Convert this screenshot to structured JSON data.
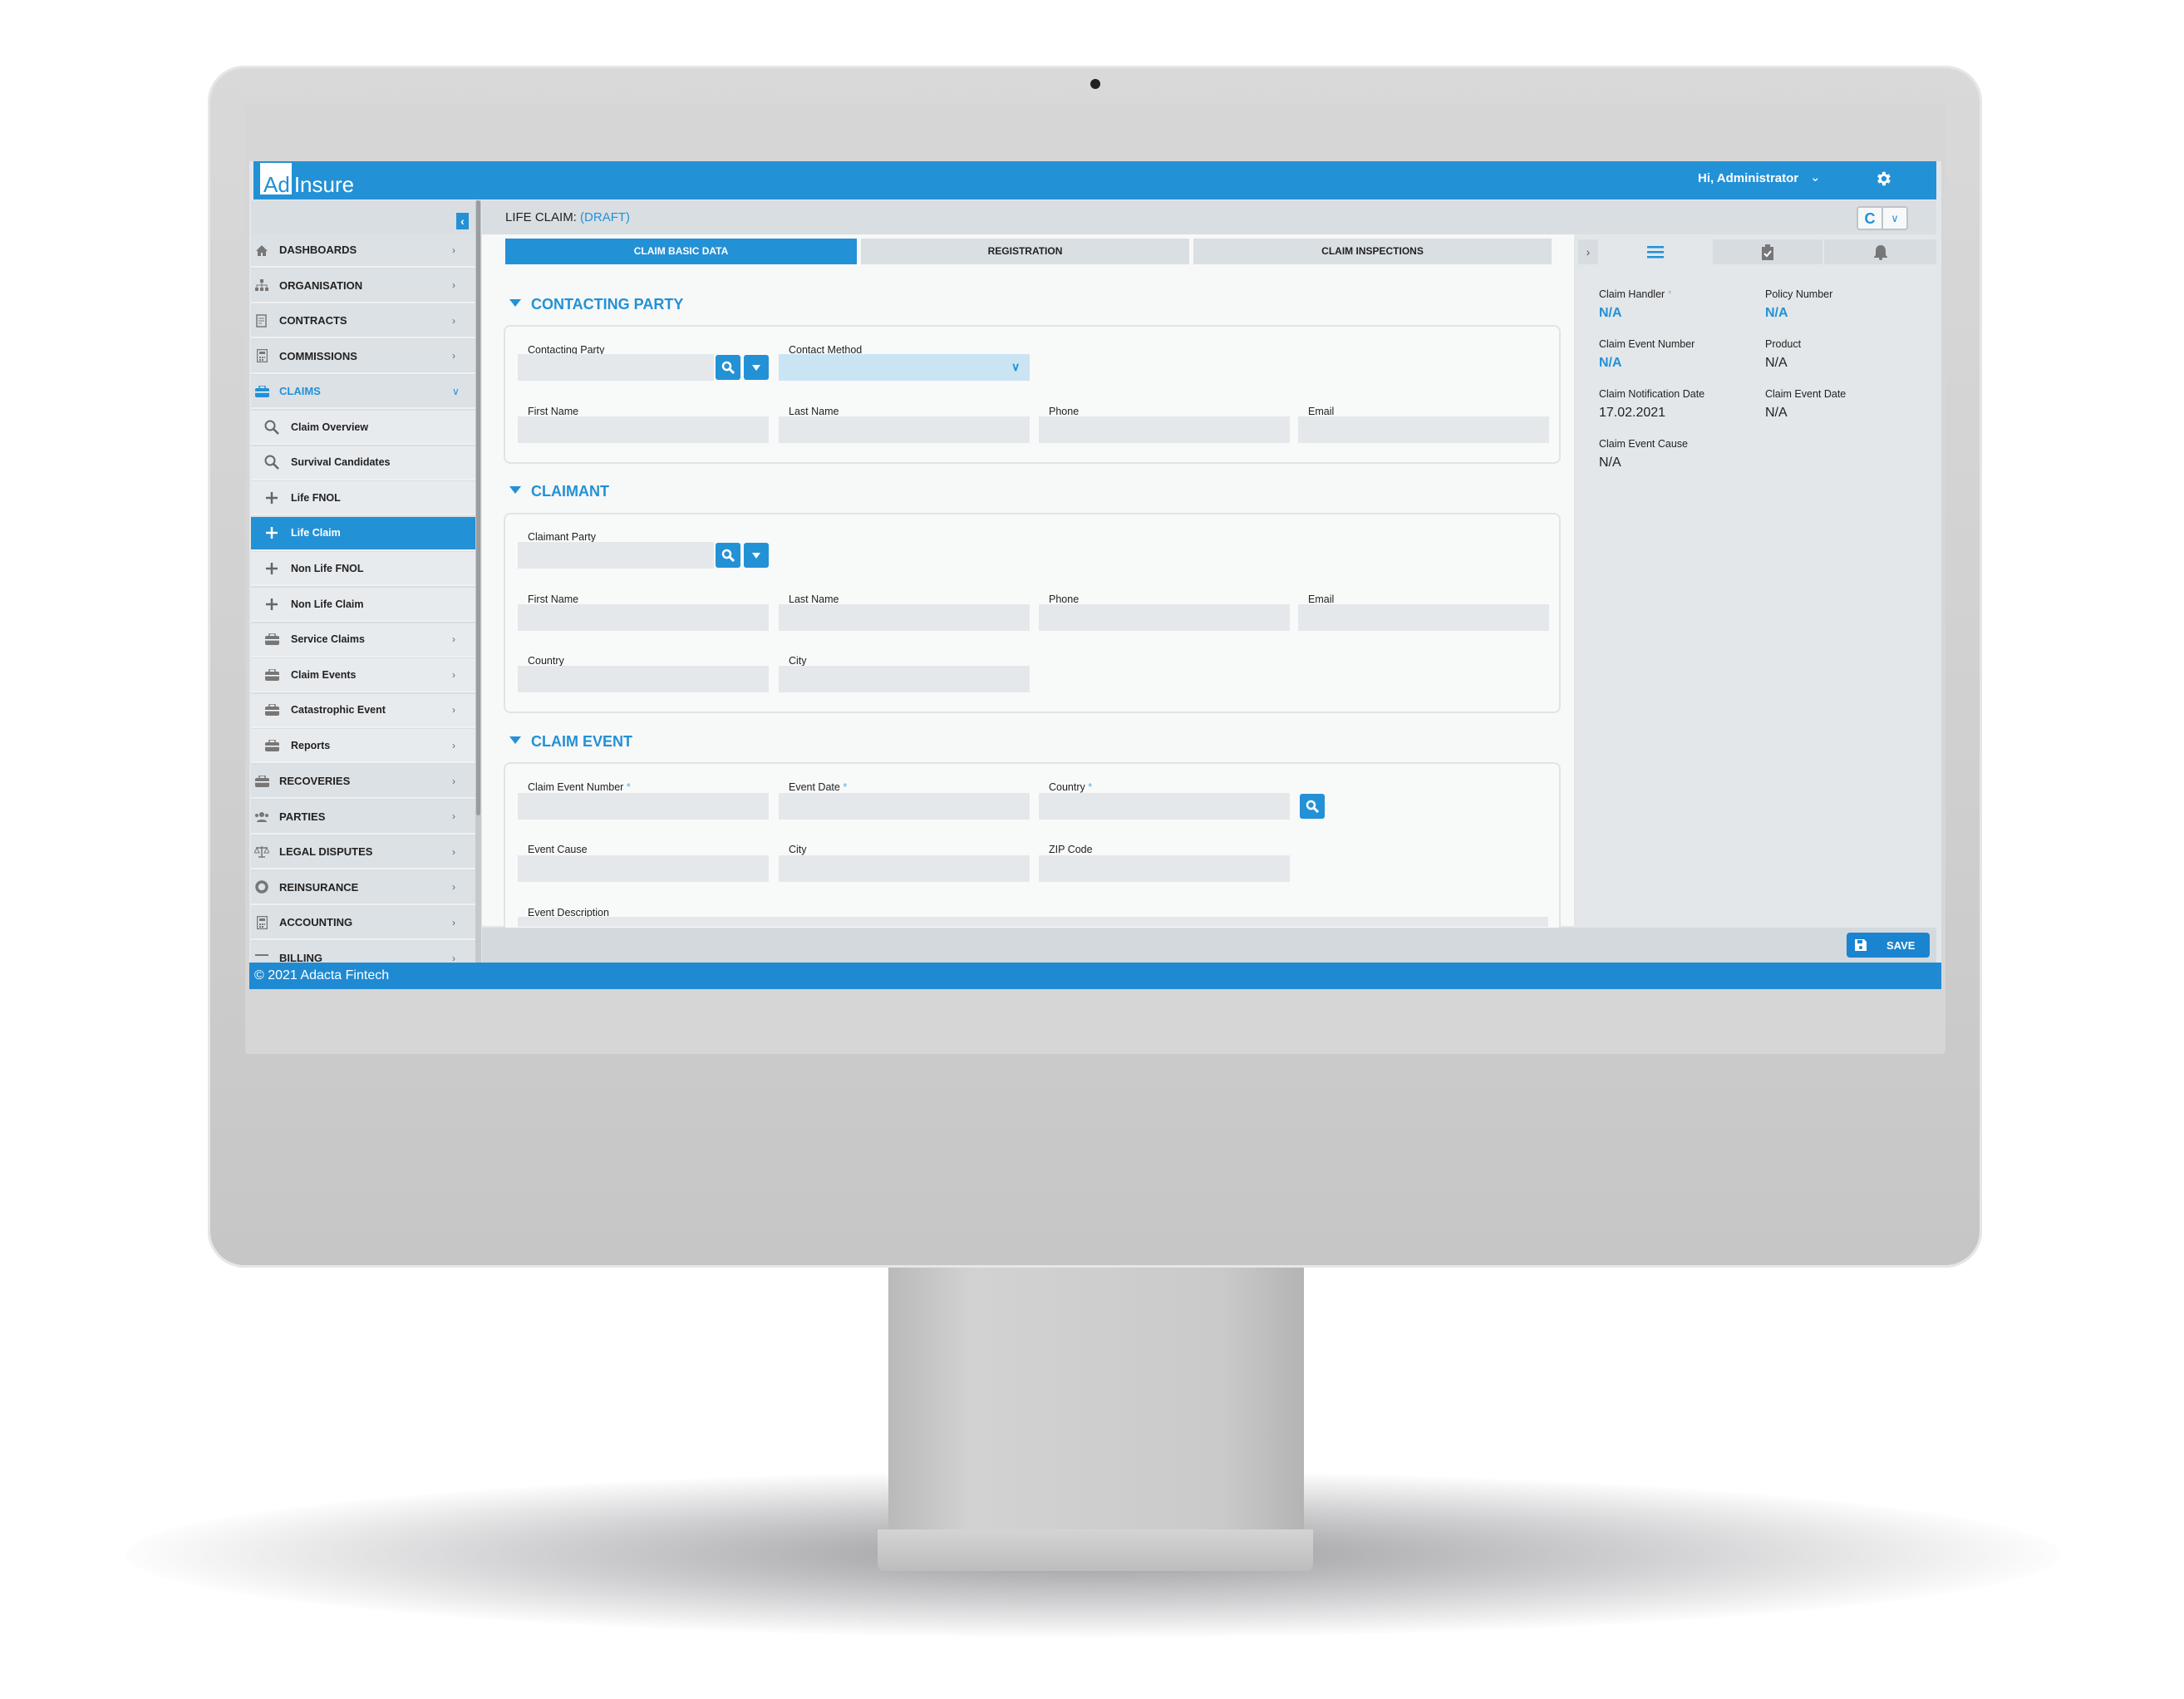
{
  "app": {
    "logo_ad": "Ad",
    "logo_insure": "Insure",
    "greeting": "Hi, Administrator",
    "accent": "#2391d6"
  },
  "sidebar": {
    "items": [
      {
        "label": "DASHBOARDS",
        "icon": "home-icon",
        "level": "top",
        "chevron": "right"
      },
      {
        "label": "ORGANISATION",
        "icon": "sitemap-icon",
        "level": "top",
        "chevron": "right"
      },
      {
        "label": "CONTRACTS",
        "icon": "contract-icon",
        "level": "top",
        "chevron": "right"
      },
      {
        "label": "COMMISSIONS",
        "icon": "calculator-icon",
        "level": "top",
        "chevron": "right"
      },
      {
        "label": "CLAIMS",
        "icon": "briefcase-icon",
        "level": "top",
        "chevron": "down",
        "accent": true
      },
      {
        "label": "Claim Overview",
        "icon": "search-icon",
        "level": "sub"
      },
      {
        "label": "Survival Candidates",
        "icon": "search-icon",
        "level": "sub"
      },
      {
        "label": "Life FNOL",
        "icon": "plus-icon",
        "level": "sub"
      },
      {
        "label": "Life Claim",
        "icon": "plus-icon",
        "level": "sub",
        "active": true
      },
      {
        "label": "Non Life FNOL",
        "icon": "plus-icon",
        "level": "sub"
      },
      {
        "label": "Non Life Claim",
        "icon": "plus-icon",
        "level": "sub"
      },
      {
        "label": "Service Claims",
        "icon": "briefcase-icon",
        "level": "sub",
        "chevron": "right"
      },
      {
        "label": "Claim Events",
        "icon": "briefcase-icon",
        "level": "sub",
        "chevron": "right"
      },
      {
        "label": "Catastrophic Event",
        "icon": "briefcase-icon",
        "level": "sub",
        "chevron": "right"
      },
      {
        "label": "Reports",
        "icon": "briefcase-icon",
        "level": "sub",
        "chevron": "right"
      },
      {
        "label": "RECOVERIES",
        "icon": "briefcase-icon",
        "level": "top",
        "chevron": "right"
      },
      {
        "label": "PARTIES",
        "icon": "users-icon",
        "level": "top",
        "chevron": "right"
      },
      {
        "label": "LEGAL DISPUTES",
        "icon": "scales-icon",
        "level": "top",
        "chevron": "right"
      },
      {
        "label": "REINSURANCE",
        "icon": "lifering-icon",
        "level": "top",
        "chevron": "right"
      },
      {
        "label": "ACCOUNTING",
        "icon": "calculator-icon",
        "level": "top",
        "chevron": "right"
      },
      {
        "label": "BILLING",
        "icon": "billing-icon",
        "level": "top",
        "chevron": "right"
      }
    ]
  },
  "page": {
    "title": "LIFE CLAIM:",
    "status": "(DRAFT)",
    "version_button": "C"
  },
  "tabs": [
    "CLAIM BASIC DATA",
    "REGISTRATION",
    "CLAIM INSPECTIONS"
  ],
  "sections": {
    "contacting_party": {
      "title": "CONTACTING PARTY",
      "fields": [
        {
          "label": "Contacting Party",
          "value": ""
        },
        {
          "label": "Contact Method",
          "value": ""
        },
        {
          "label": "First Name",
          "value": ""
        },
        {
          "label": "Last Name",
          "value": ""
        },
        {
          "label": "Phone",
          "value": ""
        },
        {
          "label": "Email",
          "value": ""
        }
      ]
    },
    "claimant": {
      "title": "CLAIMANT",
      "fields": [
        {
          "label": "Claimant Party",
          "value": ""
        },
        {
          "label": "First Name",
          "value": ""
        },
        {
          "label": "Last Name",
          "value": ""
        },
        {
          "label": "Phone",
          "value": ""
        },
        {
          "label": "Email",
          "value": ""
        },
        {
          "label": "Country",
          "value": ""
        },
        {
          "label": "City",
          "value": ""
        }
      ]
    },
    "claim_event": {
      "title": "CLAIM EVENT",
      "fields": [
        {
          "label": "Claim Event Number",
          "required": true,
          "value": ""
        },
        {
          "label": "Event Date",
          "required": true,
          "value": ""
        },
        {
          "label": "Country",
          "required": true,
          "value": ""
        },
        {
          "label": "Event Cause",
          "value": ""
        },
        {
          "label": "City",
          "value": ""
        },
        {
          "label": "ZIP Code",
          "value": ""
        },
        {
          "label": "Event Description",
          "value": ""
        }
      ]
    }
  },
  "summary": {
    "fields": [
      {
        "label": "Claim Handler",
        "required": true,
        "value": "N/A",
        "link": true
      },
      {
        "label": "Policy Number",
        "value": "N/A",
        "link": true
      },
      {
        "label": "Claim Event Number",
        "value": "N/A",
        "link": true
      },
      {
        "label": "Product",
        "value": "N/A"
      },
      {
        "label": "Claim Notification Date",
        "value": "17.02.2021"
      },
      {
        "label": "Claim Event Date",
        "value": "N/A"
      },
      {
        "label": "Claim Event Cause",
        "value": "N/A"
      }
    ]
  },
  "actions": {
    "save": "SAVE"
  },
  "footer": {
    "copyright": "© 2021 Adacta Fintech"
  }
}
